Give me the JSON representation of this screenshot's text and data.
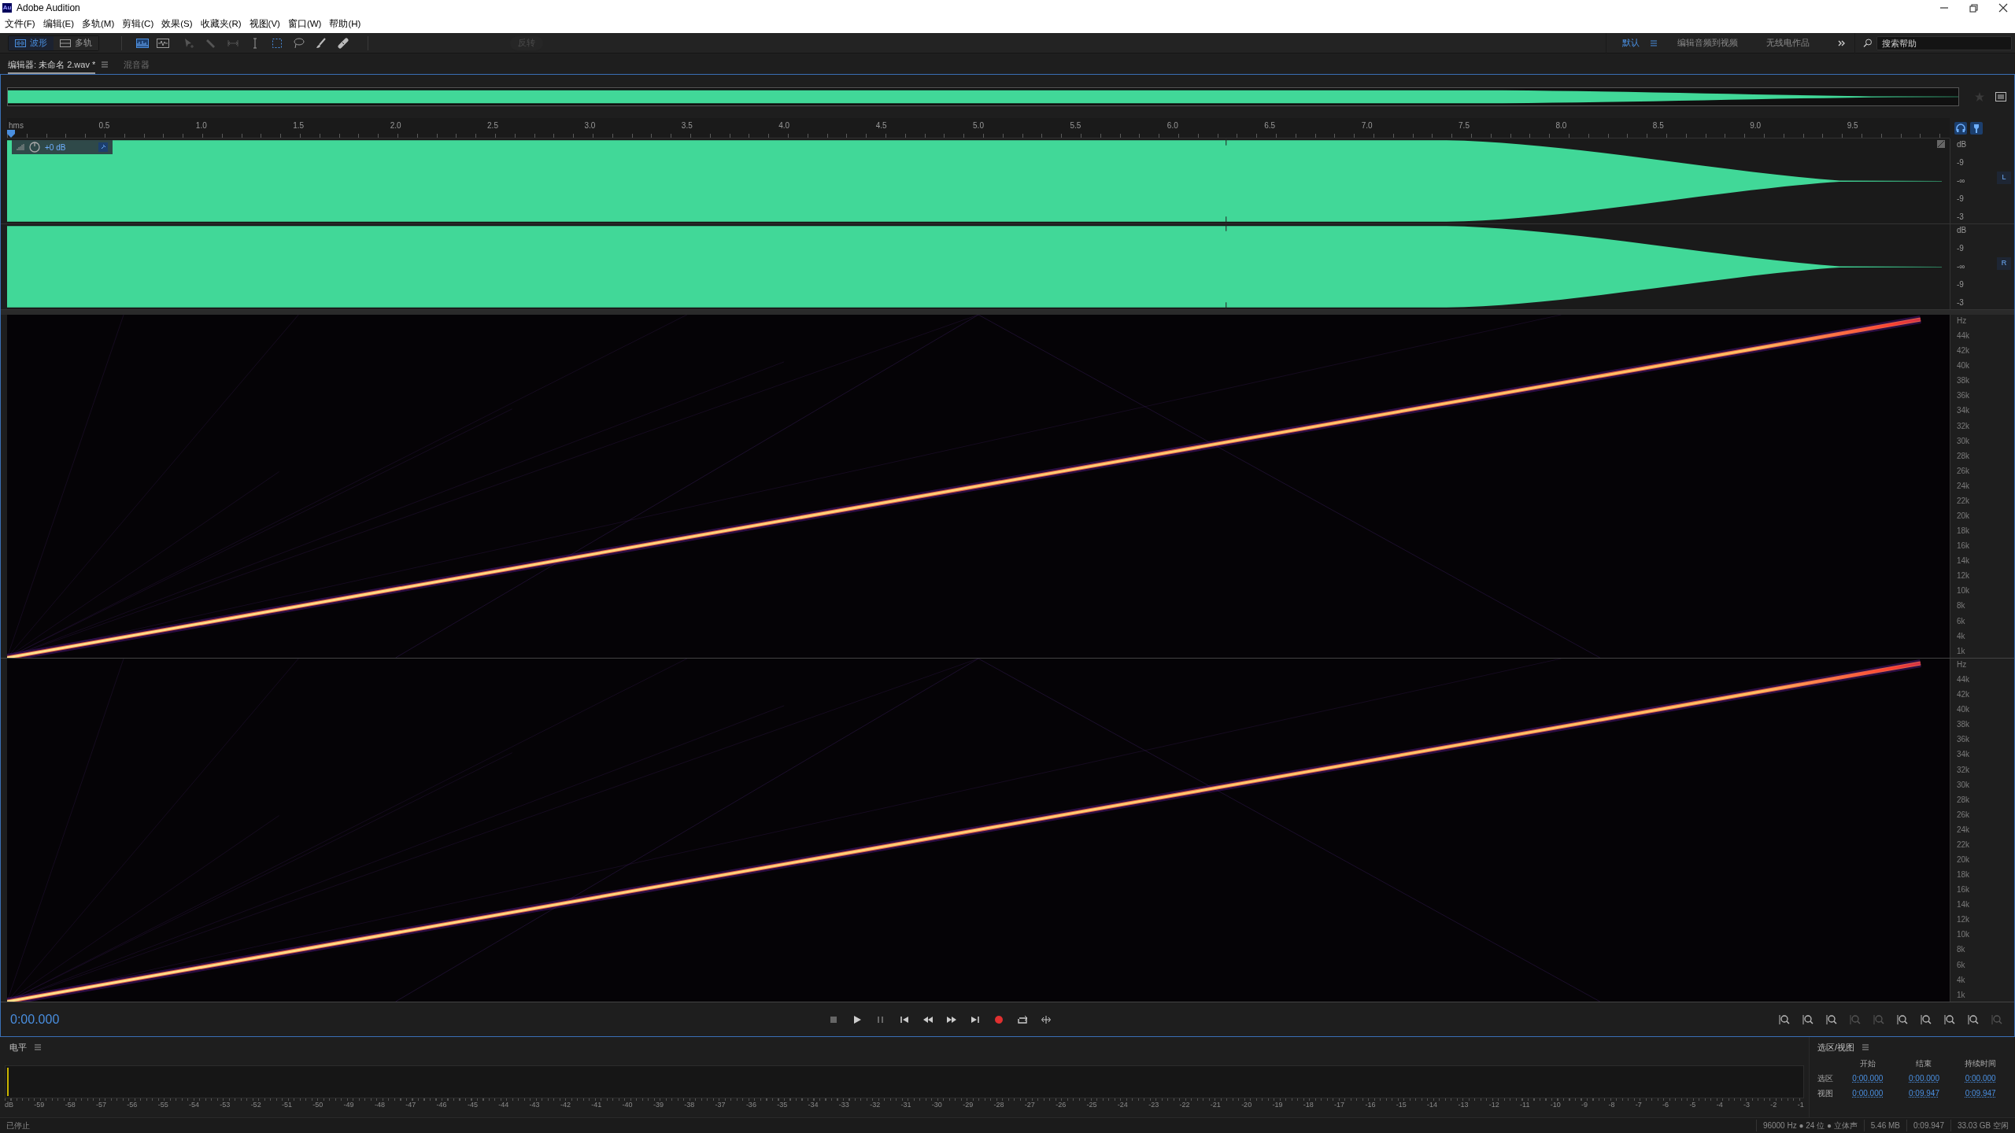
{
  "window": {
    "title": "Adobe Audition",
    "app_icon": "Au"
  },
  "menu": [
    "文件(F)",
    "编辑(E)",
    "多轨(M)",
    "剪辑(C)",
    "效果(S)",
    "收藏夹(R)",
    "视图(V)",
    "窗口(W)",
    "帮助(H)"
  ],
  "toolbar": {
    "views": [
      {
        "label": "波形",
        "selected": true
      },
      {
        "label": "多轨",
        "selected": false
      }
    ],
    "action": {
      "label": "反转",
      "disabled": true
    }
  },
  "workspaces": [
    {
      "label": "默认",
      "selected": true
    },
    {
      "label": "编辑音频到视频",
      "selected": false
    },
    {
      "label": "无线电作品",
      "selected": false
    }
  ],
  "search": {
    "placeholder": "搜索帮助"
  },
  "panel_tabs": [
    {
      "label": "编辑器: 未命名 2.wav *",
      "selected": true
    },
    {
      "label": "混音器",
      "selected": false
    }
  ],
  "ruler": {
    "unit": "hms",
    "ticks": [
      "0.5",
      "1.0",
      "1.5",
      "2.0",
      "2.5",
      "3.0",
      "3.5",
      "4.0",
      "4.5",
      "5.0",
      "5.5",
      "6.0",
      "6.5",
      "7.0",
      "7.5",
      "8.0",
      "8.5",
      "9.0",
      "9.5"
    ]
  },
  "clip_overlay": {
    "gain": "+0 dB"
  },
  "channels": [
    {
      "badge": "L",
      "scale": [
        "dB",
        "-9",
        "-∞",
        "-9",
        "-3"
      ]
    },
    {
      "badge": "R",
      "scale": [
        "dB",
        "-9",
        "-∞",
        "-9",
        "-3"
      ]
    }
  ],
  "spectrograms": [
    {
      "scale": [
        "Hz",
        "44k",
        "42k",
        "40k",
        "38k",
        "36k",
        "34k",
        "32k",
        "30k",
        "28k",
        "26k",
        "24k",
        "22k",
        "20k",
        "18k",
        "16k",
        "14k",
        "12k",
        "10k",
        "8k",
        "6k",
        "4k",
        "1k"
      ]
    },
    {
      "scale": [
        "Hz",
        "44k",
        "42k",
        "40k",
        "38k",
        "36k",
        "34k",
        "32k",
        "30k",
        "28k",
        "26k",
        "24k",
        "22k",
        "20k",
        "18k",
        "16k",
        "14k",
        "12k",
        "10k",
        "8k",
        "6k",
        "4k",
        "1k"
      ]
    }
  ],
  "transport": {
    "time": "0:00.000"
  },
  "level_panel": {
    "title": "电平",
    "ticks": [
      "dB",
      "-59",
      "-58",
      "-57",
      "-56",
      "-55",
      "-54",
      "-53",
      "-52",
      "-51",
      "-50",
      "-49",
      "-48",
      "-47",
      "-46",
      "-45",
      "-44",
      "-43",
      "-42",
      "-41",
      "-40",
      "-39",
      "-38",
      "-37",
      "-36",
      "-35",
      "-34",
      "-33",
      "-32",
      "-31",
      "-30",
      "-29",
      "-28",
      "-27",
      "-26",
      "-25",
      "-24",
      "-23",
      "-22",
      "-21",
      "-20",
      "-19",
      "-18",
      "-17",
      "-16",
      "-15",
      "-14",
      "-13",
      "-12",
      "-11",
      "-10",
      "-9",
      "-8",
      "-7",
      "-6",
      "-5",
      "-4",
      "-3",
      "-2",
      "-1"
    ]
  },
  "selection_panel": {
    "title": "选区/视图",
    "columns": [
      "开始",
      "结束",
      "持续时间"
    ],
    "rows": [
      {
        "label": "选区",
        "values": [
          "0:00.000",
          "0:00.000",
          "0:00.000"
        ]
      },
      {
        "label": "视图",
        "values": [
          "0:00.000",
          "0:09.947",
          "0:09.947"
        ]
      }
    ]
  },
  "status_bar": {
    "state": "已停止",
    "items": [
      "96000 Hz ● 24 位 ● 立体声",
      "5.46 MB",
      "0:09.947",
      "33.03 GB 空闲"
    ]
  }
}
